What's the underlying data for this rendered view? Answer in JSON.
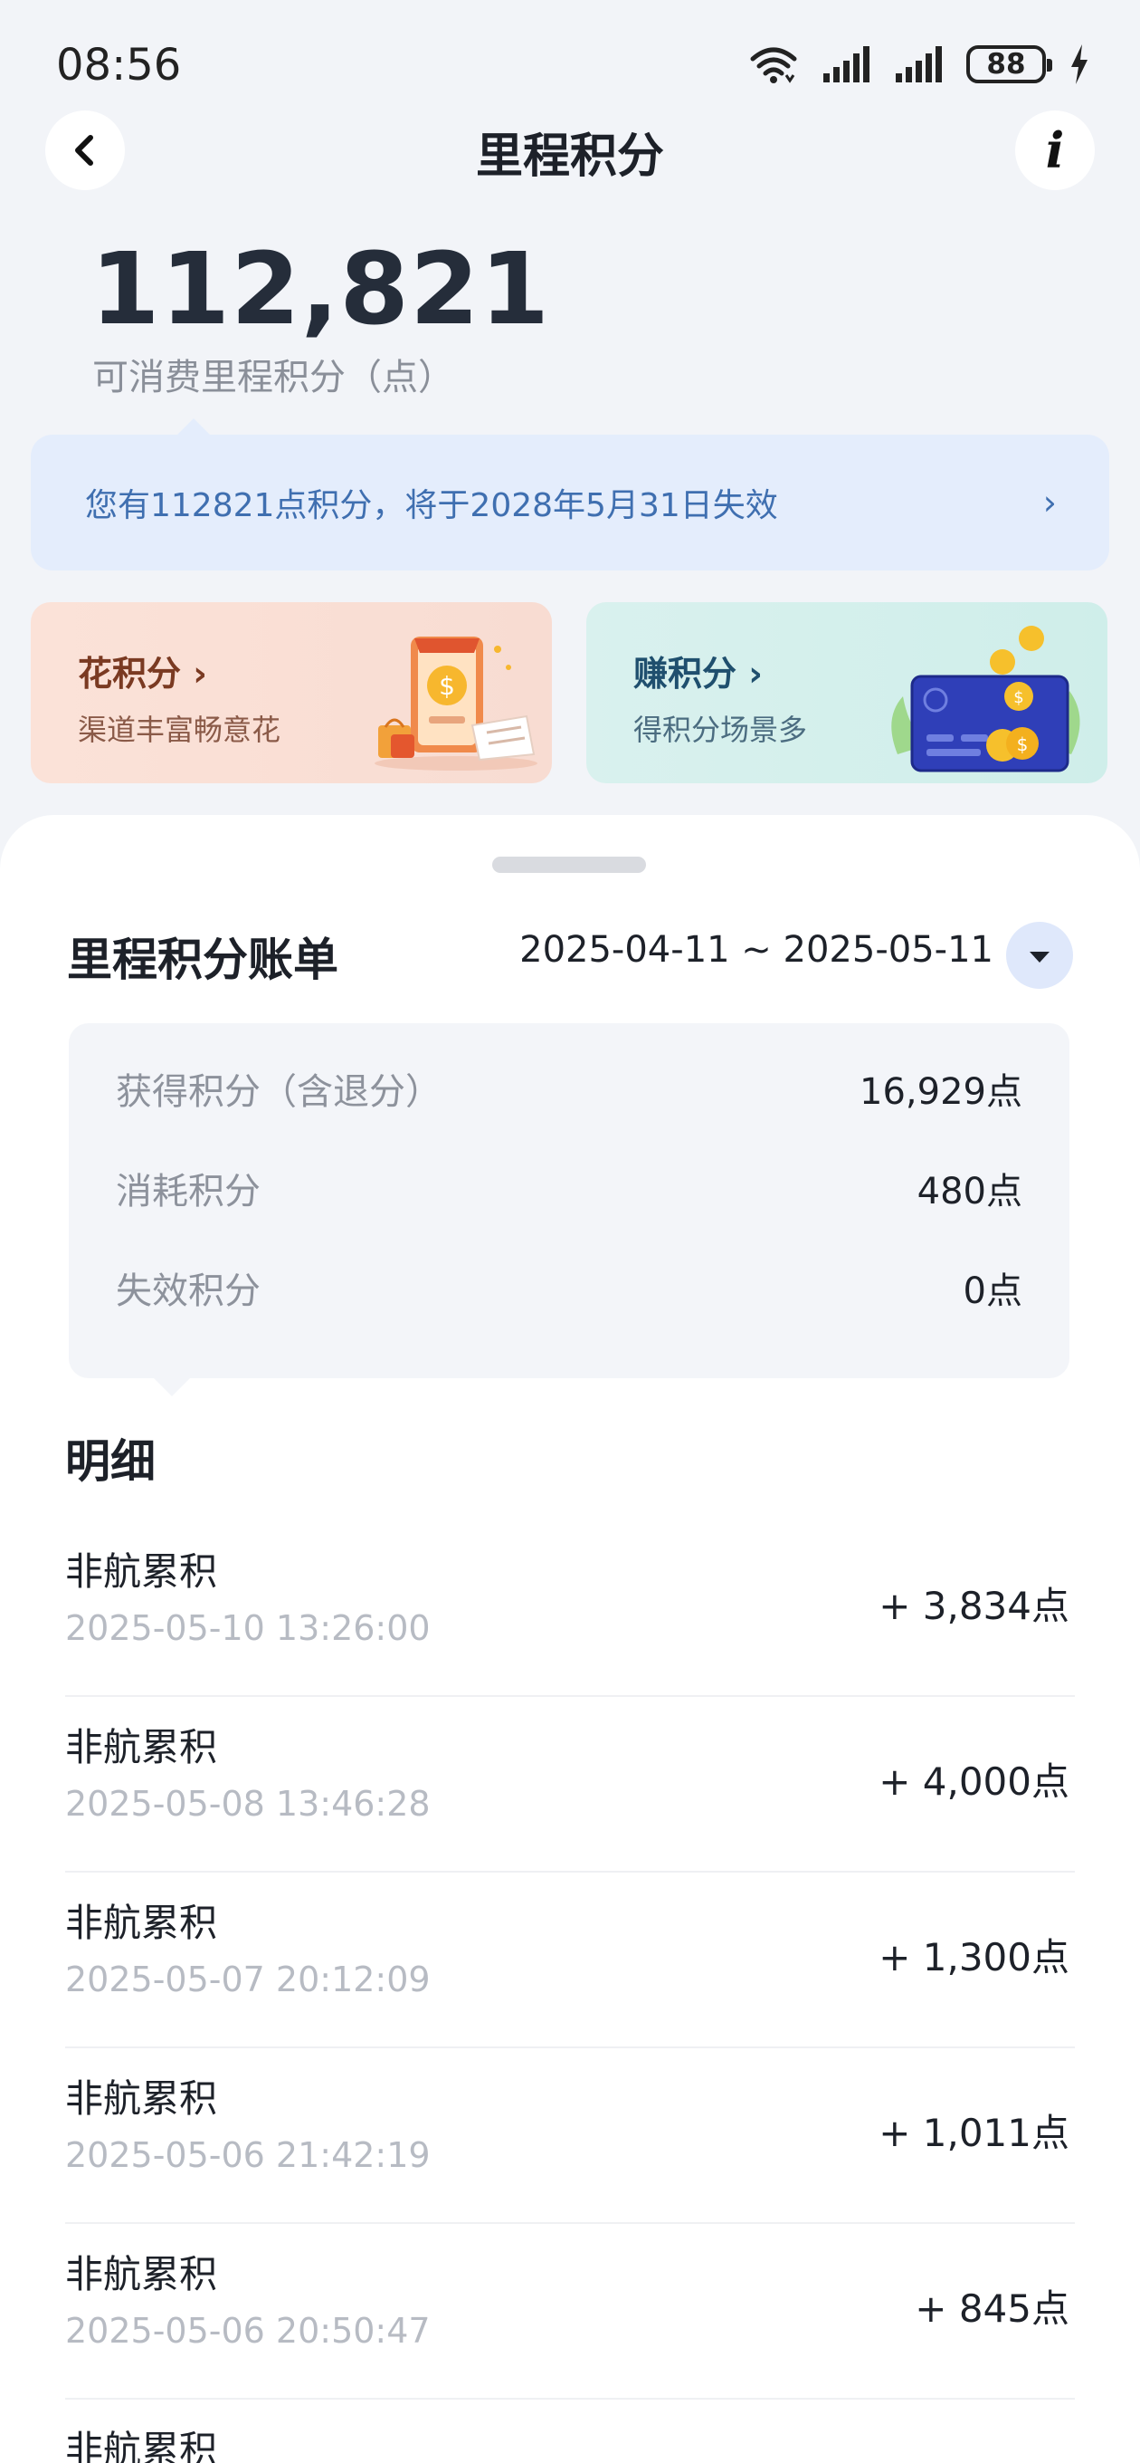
{
  "status_bar": {
    "time": "08:56",
    "battery": "88"
  },
  "nav": {
    "title": "里程积分"
  },
  "balance": {
    "value": "112,821",
    "label": "可消费里程积分（点）"
  },
  "notice": {
    "text": "您有112821点积分，将于2028年5月31日失效",
    "arrow": "›"
  },
  "cards": {
    "spend": {
      "title": "花积分 ›",
      "subtitle": "渠道丰富畅意花"
    },
    "earn": {
      "title": "赚积分 ›",
      "subtitle": "得积分场景多"
    }
  },
  "bill": {
    "title": "里程积分账单",
    "date_range": "2025-04-11 ~ 2025-05-11",
    "summary": [
      {
        "label": "获得积分（含退分）",
        "value": "16,929点"
      },
      {
        "label": "消耗积分",
        "value": "480点"
      },
      {
        "label": "失效积分",
        "value": "0点"
      }
    ]
  },
  "details": {
    "title": "明细",
    "items": [
      {
        "title": "非航累积",
        "time": "2025-05-10 13:26:00",
        "amount": "+ 3,834点"
      },
      {
        "title": "非航累积",
        "time": "2025-05-08 13:46:28",
        "amount": "+ 4,000点"
      },
      {
        "title": "非航累积",
        "time": "2025-05-07 20:12:09",
        "amount": "+ 1,300点"
      },
      {
        "title": "非航累积",
        "time": "2025-05-06 21:42:19",
        "amount": "+ 1,011点"
      },
      {
        "title": "非航累积",
        "time": "2025-05-06 20:50:47",
        "amount": "+ 845点"
      },
      {
        "title": "非航累积",
        "time": "",
        "amount": ""
      }
    ]
  },
  "icons": {
    "back": "chevron-left-icon",
    "info": "info-icon",
    "wifi": "wifi-icon",
    "signal": "signal-icon",
    "battery": "battery-icon",
    "charging": "lightning-icon"
  },
  "colors": {
    "background": "#f2f4f8",
    "notice_bg": "#e4edfc",
    "notice_text": "#3f6fb0",
    "spend_card": "#fbe2d8",
    "earn_card": "#d9f1ee"
  }
}
